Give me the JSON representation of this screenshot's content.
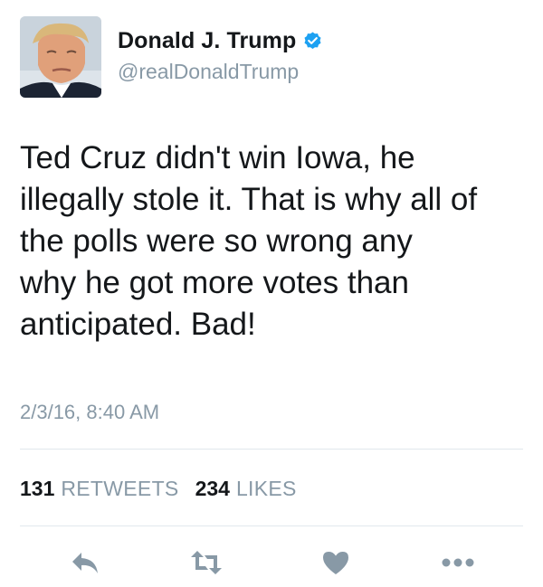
{
  "author": {
    "display_name": "Donald J. Trump",
    "handle": "@realDonaldTrump",
    "verified": true
  },
  "tweet": {
    "text": "Ted Cruz didn't win Iowa, he\nillegally stole it. That is why all of\nthe polls were so wrong any\nwhy he got more votes than\nanticipated. Bad!",
    "timestamp": "2/3/16, 8:40 AM"
  },
  "stats": {
    "retweets_count": "131",
    "retweets_label": "RETWEETS",
    "likes_count": "234",
    "likes_label": "LIKES"
  },
  "actions": {
    "reply_icon": "reply-icon",
    "retweet_icon": "retweet-icon",
    "like_icon": "heart-icon",
    "more_icon": "more-icon"
  },
  "colors": {
    "text": "#14171a",
    "muted": "#8899a6",
    "verified_blue": "#1da1f2",
    "divider": "#e1e8ed"
  }
}
